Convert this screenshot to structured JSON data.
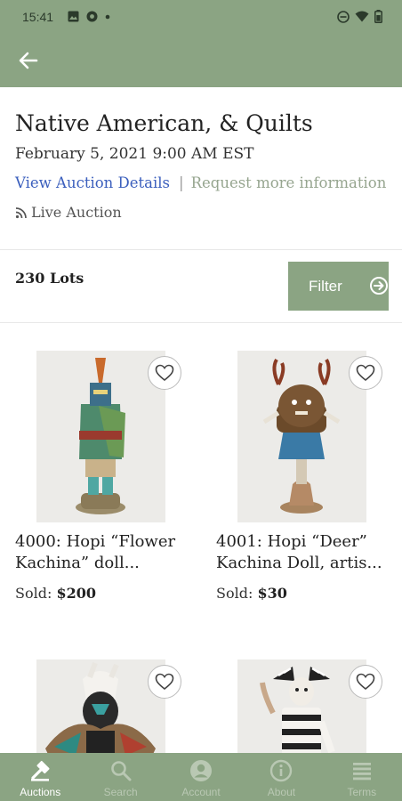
{
  "status_bar": {
    "time": "15:41"
  },
  "auction": {
    "title": "Native American, & Quilts",
    "date": "February 5, 2021 9:00 AM EST",
    "view_details": "View Auction Details",
    "separator": "|",
    "request_info": "Request more information",
    "type": "Live Auction"
  },
  "lots_bar": {
    "count": "230 Lots",
    "filter_label": "Filter"
  },
  "lots": [
    {
      "title_line1": "4000: Hopi “Flower",
      "title_line2": "Kachina” doll...",
      "sold_label": "Sold:",
      "sold_price": "$200"
    },
    {
      "title_line1": "4001: Hopi “Deer”",
      "title_line2": "Kachina Doll, artis...",
      "sold_label": "Sold:",
      "sold_price": "$30"
    },
    {
      "title_line1": "",
      "title_line2": "",
      "sold_label": "",
      "sold_price": ""
    },
    {
      "title_line1": "",
      "title_line2": "",
      "sold_label": "",
      "sold_price": ""
    }
  ],
  "bottom_nav": [
    {
      "label": "Auctions",
      "icon": "gavel-icon",
      "active": true
    },
    {
      "label": "Search",
      "icon": "search-icon",
      "active": false
    },
    {
      "label": "Account",
      "icon": "account-icon",
      "active": false
    },
    {
      "label": "About",
      "icon": "info-icon",
      "active": false
    },
    {
      "label": "Terms",
      "icon": "terms-icon",
      "active": false
    }
  ],
  "colors": {
    "brand_green": "#8ba483",
    "link_blue": "#3b5fbd",
    "muted_link": "#96a58f"
  }
}
